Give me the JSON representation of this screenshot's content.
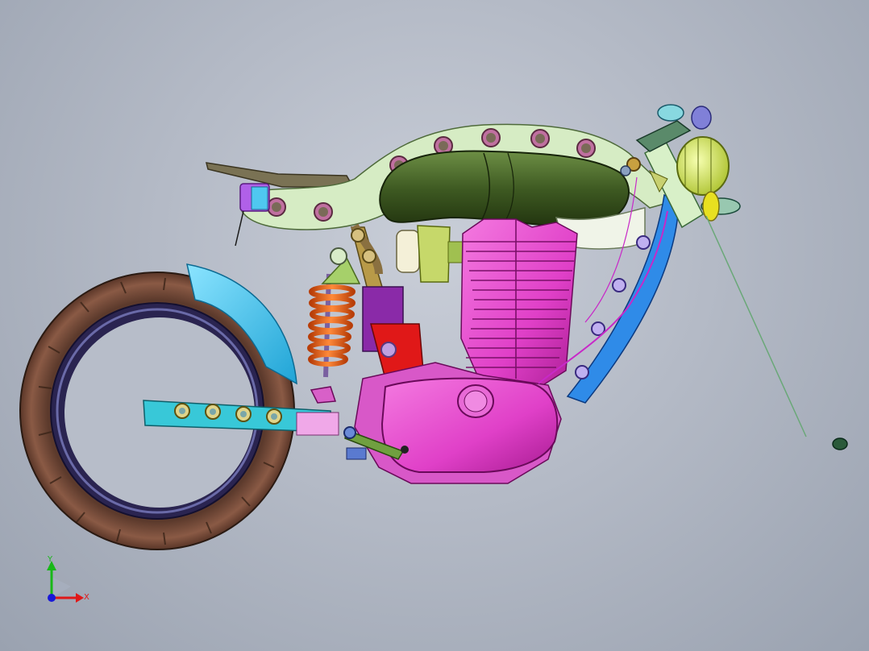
{
  "viewport": {
    "background_top": "#c9ced8",
    "background_bottom": "#9aa2b0"
  },
  "model": {
    "parts": [
      "rear-tire",
      "rear-rim",
      "rear-fender",
      "swingarm",
      "rear-shock",
      "shock-spring",
      "frame-backbone",
      "seat-pan",
      "fuel-tank",
      "carburetor",
      "air-cleaner",
      "engine-cylinders",
      "engine-crankcase",
      "primary-cover",
      "gear-linkage",
      "front-frame-downtube",
      "steering-head",
      "headlight",
      "fork-lower",
      "brake-line",
      "front-axle-cap"
    ],
    "colors": {
      "tire": "#7a5140",
      "fender": "#3fc0ea",
      "swingarm": "#38c8d8",
      "spring": "#f06a1a",
      "frame": "#d6ecc4",
      "tank": "#3e5a22",
      "engine": "#e040c8",
      "downtube": "#2f8be8",
      "headlight": "#d8e86a",
      "bracket_red": "#e01818"
    }
  },
  "triad": {
    "x_label": "X",
    "y_label": "Y",
    "x_color": "#e01818",
    "y_color": "#18b818",
    "z_color": "#1818d8"
  }
}
